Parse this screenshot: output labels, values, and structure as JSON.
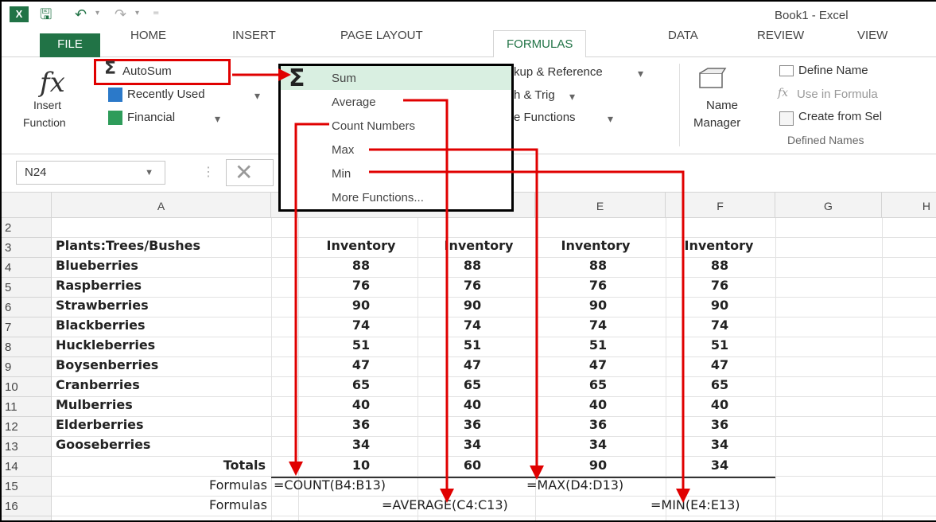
{
  "title": "Book1 - Excel",
  "tabs": [
    "FILE",
    "HOME",
    "INSERT",
    "PAGE LAYOUT",
    "FORMULAS",
    "DATA",
    "REVIEW",
    "VIEW"
  ],
  "ribbon": {
    "insert_function": [
      "Insert",
      "Function"
    ],
    "autosum": "AutoSum",
    "recently_used": "Recently Used",
    "financial": "Financial",
    "lookup": "kup & Reference",
    "math": "h & Trig",
    "more_functions": "e Functions",
    "name_manager": [
      "Name",
      "Manager"
    ],
    "define_name": "Define Name",
    "use_in_formula": "Use in Formula",
    "create_from_sel": "Create from Sel",
    "defined_names": "Defined Names"
  },
  "name_box": "N24",
  "menu": {
    "items": [
      "Sum",
      "Average",
      "Count Numbers",
      "Max",
      "Min",
      "More Functions..."
    ]
  },
  "columns": [
    "A",
    "E",
    "F",
    "G",
    "H"
  ],
  "rows": [
    "2",
    "3",
    "4",
    "5",
    "6",
    "7",
    "8",
    "9",
    "10",
    "11",
    "12",
    "13",
    "14",
    "15",
    "16"
  ],
  "sheet": {
    "header_label": "Plants:Trees/Bushes",
    "inventory_headers": [
      "Inventory",
      "Inventory",
      "Inventory",
      "Inventory"
    ],
    "plants": [
      "Blueberries",
      "Raspberries",
      "Strawberries",
      "Blackberries",
      "Huckleberries",
      "Boysenberries",
      "Cranberries",
      "Mulberries",
      "Elderberries",
      "Gooseberries"
    ],
    "values": [
      "88",
      "76",
      "90",
      "74",
      "51",
      "47",
      "65",
      "40",
      "36",
      "34"
    ],
    "totals_label": "Totals",
    "totals": [
      "10",
      "60",
      "90",
      "34"
    ],
    "formulas_label": "Formulas",
    "formula_count": "=COUNT(B4:B13)",
    "formula_max": "=MAX(D4:D13)",
    "formula_average": "=AVERAGE(C4:C13)",
    "formula_min": "=MIN(E4:E13)"
  },
  "colors": {
    "excel_green": "#217346",
    "annotation_red": "#e00000",
    "menu_highlight": "#d9efe1"
  }
}
